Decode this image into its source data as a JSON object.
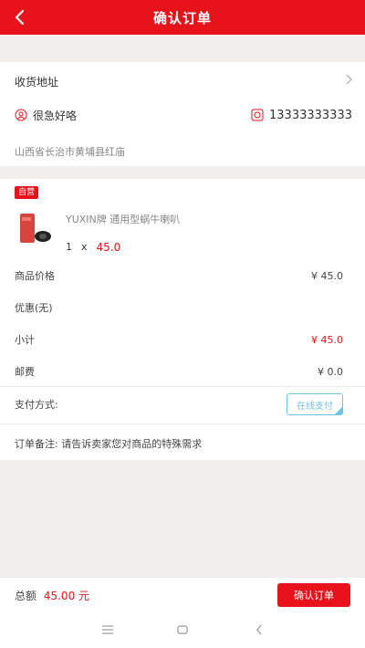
{
  "header": {
    "title": "确认订单",
    "back_icon": "back-arrow-icon"
  },
  "address": {
    "label": "收货地址",
    "name": "很急好咯",
    "phone": "13333333333",
    "detail": "山西省长治市黄埔县红庙"
  },
  "product": {
    "badge": "自营",
    "name": "YUXIN牌 通用型蜗牛喇叭",
    "qty": "1",
    "times": "x",
    "price": "45.0"
  },
  "summary": {
    "goods_price_label": "商品价格",
    "goods_price_value": "¥ 45.0",
    "discount_label": "优惠(无)",
    "subtotal_label": "小计",
    "subtotal_value": "¥ 45.0",
    "shipping_label": "邮费",
    "shipping_value": "¥ 0.0"
  },
  "payment": {
    "label": "支付方式:",
    "option": "在线支付"
  },
  "note": {
    "text": "订单备注: 请告诉卖家您对商品的特殊需求"
  },
  "footer": {
    "total_label": "总额",
    "total_value": "45.00 元",
    "confirm_label": "确认订单"
  },
  "colors": {
    "accent": "#e8121b",
    "pay_border": "#6cc3e8"
  }
}
